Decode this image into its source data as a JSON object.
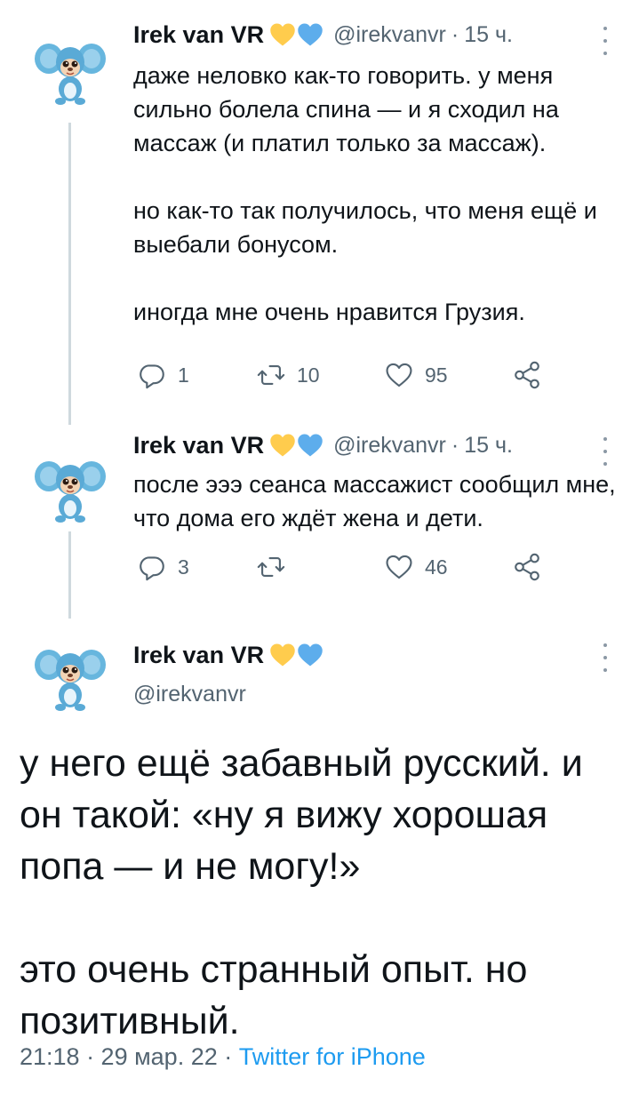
{
  "tweets": [
    {
      "name": "Irek van VR",
      "handle": "@irekvanvr",
      "separator": "·",
      "time": "15 ч.",
      "paragraphs": [
        "даже неловко как-то говорить. у меня сильно болела спина — и я сходил на массаж (и платил только за массаж).",
        "но как-то так получилось, что меня ещё и выебали бонусом.",
        "иногда мне очень нравится Грузия."
      ],
      "reply_count": "1",
      "retweet_count": "10",
      "like_count": "95"
    },
    {
      "name": "Irek van VR",
      "handle": "@irekvanvr",
      "separator": "·",
      "time": "15 ч.",
      "paragraphs": [
        "после эээ сеанса массажист сообщил мне, что дома его ждёт жена и дети."
      ],
      "reply_count": "3",
      "retweet_count": "",
      "like_count": "46"
    }
  ],
  "main_tweet": {
    "name": "Irek van VR",
    "handle": "@irekvanvr",
    "paragraphs": [
      "у него ещё забавный русский. и он такой: «ну я вижу хорошая попа — и не могу!»",
      "это очень странный опыт. но позитивный."
    ],
    "timestamp": "21:18 · 29 мар. 22 · ",
    "source": "Twitter for iPhone"
  },
  "colors": {
    "heart_yellow": "#ffcc4d",
    "heart_blue": "#5dadec",
    "link": "#1d9bf0",
    "secondary_text": "#536471",
    "thread_line": "#cfd9de"
  },
  "icons": {
    "avatar": "cheburashka-toy-avatar",
    "reply": "reply-bubble-icon",
    "retweet": "retweet-arrows-icon",
    "like": "heart-outline-icon",
    "share": "share-icon",
    "more": "vertical-ellipsis-icon"
  }
}
